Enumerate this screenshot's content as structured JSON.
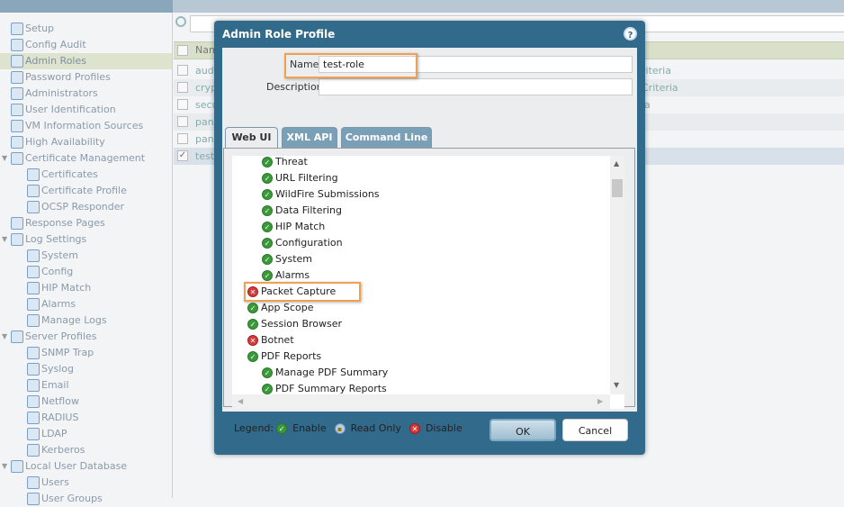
{
  "sidebar": {
    "items": [
      {
        "label": "Setup",
        "level": 0
      },
      {
        "label": "Config Audit",
        "level": 0
      },
      {
        "label": "Admin Roles",
        "level": 0,
        "selected": true
      },
      {
        "label": "Password Profiles",
        "level": 0
      },
      {
        "label": "Administrators",
        "level": 0
      },
      {
        "label": "User Identification",
        "level": 0
      },
      {
        "label": "VM Information Sources",
        "level": 0
      },
      {
        "label": "High Availability",
        "level": 0
      },
      {
        "label": "Certificate Management",
        "level": 0,
        "expanded": true
      },
      {
        "label": "Certificates",
        "level": 1
      },
      {
        "label": "Certificate Profile",
        "level": 1
      },
      {
        "label": "OCSP Responder",
        "level": 1
      },
      {
        "label": "Response Pages",
        "level": 0
      },
      {
        "label": "Log Settings",
        "level": 0,
        "expanded": true
      },
      {
        "label": "System",
        "level": 1
      },
      {
        "label": "Config",
        "level": 1
      },
      {
        "label": "HIP Match",
        "level": 1
      },
      {
        "label": "Alarms",
        "level": 1
      },
      {
        "label": "Manage Logs",
        "level": 1
      },
      {
        "label": "Server Profiles",
        "level": 0,
        "expanded": true
      },
      {
        "label": "SNMP Trap",
        "level": 1
      },
      {
        "label": "Syslog",
        "level": 1
      },
      {
        "label": "Email",
        "level": 1
      },
      {
        "label": "Netflow",
        "level": 1
      },
      {
        "label": "RADIUS",
        "level": 1
      },
      {
        "label": "LDAP",
        "level": 1
      },
      {
        "label": "Kerberos",
        "level": 1
      },
      {
        "label": "Local User Database",
        "level": 0,
        "expanded": true
      },
      {
        "label": "Users",
        "level": 1
      },
      {
        "label": "User Groups",
        "level": 1
      }
    ]
  },
  "table": {
    "header": "Nam",
    "rows": [
      {
        "name": "audi",
        "crit": "riteria",
        "checked": false
      },
      {
        "name": "cryp",
        "crit": "Criteria",
        "checked": false
      },
      {
        "name": "secu",
        "crit": "ia",
        "checked": false
      },
      {
        "name": "panl",
        "crit": "",
        "checked": false
      },
      {
        "name": "panl",
        "crit": "",
        "checked": false
      },
      {
        "name": "test",
        "crit": "",
        "checked": true
      }
    ]
  },
  "dialog": {
    "title": "Admin Role Profile",
    "name_label": "Name",
    "name_value": "test-role",
    "description_label": "Description",
    "description_value": "",
    "tabs": [
      "Web UI",
      "XML API",
      "Command Line"
    ],
    "active_tab": "Web UI",
    "items": [
      {
        "label": "Threat",
        "status": "enable",
        "level": 2
      },
      {
        "label": "URL Filtering",
        "status": "enable",
        "level": 2
      },
      {
        "label": "WildFire Submissions",
        "status": "enable",
        "level": 2
      },
      {
        "label": "Data Filtering",
        "status": "enable",
        "level": 2
      },
      {
        "label": "HIP Match",
        "status": "enable",
        "level": 2
      },
      {
        "label": "Configuration",
        "status": "enable",
        "level": 2
      },
      {
        "label": "System",
        "status": "enable",
        "level": 2
      },
      {
        "label": "Alarms",
        "status": "enable",
        "level": 2
      },
      {
        "label": "Packet Capture",
        "status": "disable",
        "level": 1,
        "highlighted": true
      },
      {
        "label": "App Scope",
        "status": "enable",
        "level": 1
      },
      {
        "label": "Session Browser",
        "status": "enable",
        "level": 1
      },
      {
        "label": "Botnet",
        "status": "disable",
        "level": 1
      },
      {
        "label": "PDF Reports",
        "status": "enable",
        "level": 1
      },
      {
        "label": "Manage PDF Summary",
        "status": "enable",
        "level": 2
      },
      {
        "label": "PDF Summary Reports",
        "status": "enable",
        "level": 2
      }
    ],
    "legend": {
      "title": "Legend:",
      "enable": "Enable",
      "read_only": "Read Only",
      "disable": "Disable"
    },
    "ok": "OK",
    "cancel": "Cancel"
  },
  "colors": {
    "dialog": "#316a8a",
    "highlight": "#f0a050",
    "enable": "#3a9a3a",
    "disable": "#d63a3a"
  }
}
